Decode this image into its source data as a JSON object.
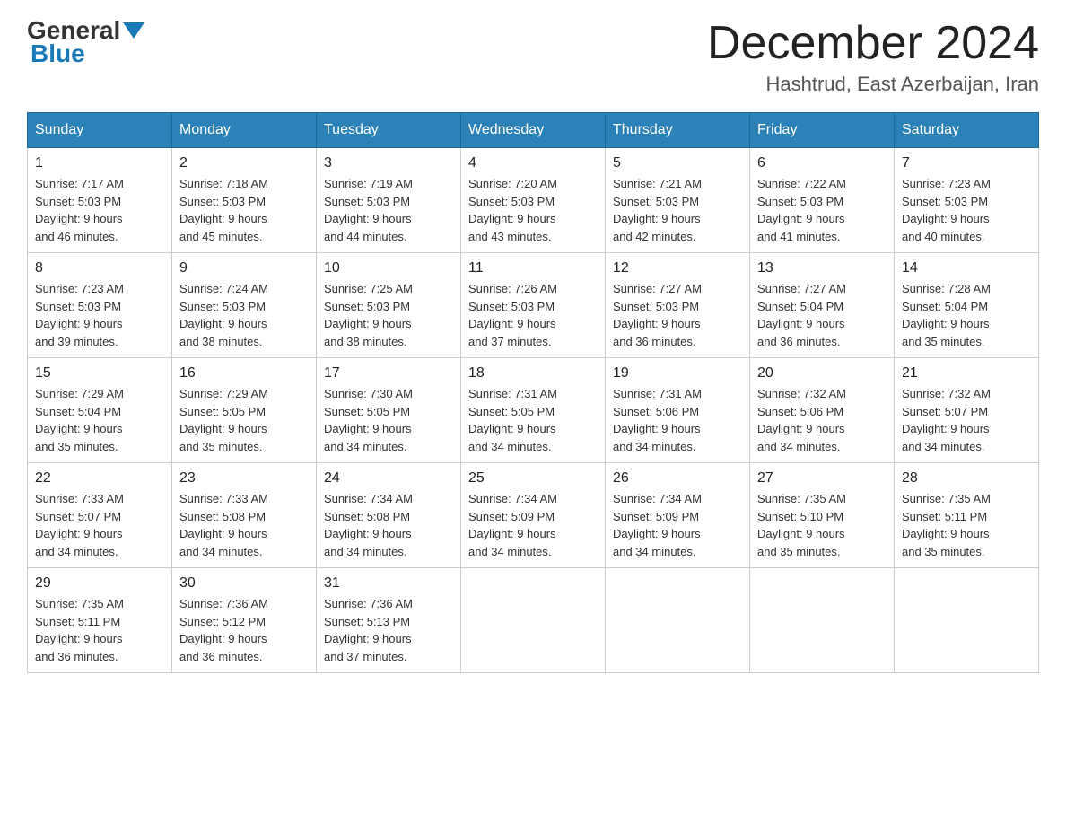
{
  "header": {
    "logo_general": "General",
    "logo_blue": "Blue",
    "main_title": "December 2024",
    "subtitle": "Hashtrud, East Azerbaijan, Iran"
  },
  "days_of_week": [
    "Sunday",
    "Monday",
    "Tuesday",
    "Wednesday",
    "Thursday",
    "Friday",
    "Saturday"
  ],
  "weeks": [
    [
      {
        "day": "1",
        "sunrise": "7:17 AM",
        "sunset": "5:03 PM",
        "daylight": "9 hours and 46 minutes."
      },
      {
        "day": "2",
        "sunrise": "7:18 AM",
        "sunset": "5:03 PM",
        "daylight": "9 hours and 45 minutes."
      },
      {
        "day": "3",
        "sunrise": "7:19 AM",
        "sunset": "5:03 PM",
        "daylight": "9 hours and 44 minutes."
      },
      {
        "day": "4",
        "sunrise": "7:20 AM",
        "sunset": "5:03 PM",
        "daylight": "9 hours and 43 minutes."
      },
      {
        "day": "5",
        "sunrise": "7:21 AM",
        "sunset": "5:03 PM",
        "daylight": "9 hours and 42 minutes."
      },
      {
        "day": "6",
        "sunrise": "7:22 AM",
        "sunset": "5:03 PM",
        "daylight": "9 hours and 41 minutes."
      },
      {
        "day": "7",
        "sunrise": "7:23 AM",
        "sunset": "5:03 PM",
        "daylight": "9 hours and 40 minutes."
      }
    ],
    [
      {
        "day": "8",
        "sunrise": "7:23 AM",
        "sunset": "5:03 PM",
        "daylight": "9 hours and 39 minutes."
      },
      {
        "day": "9",
        "sunrise": "7:24 AM",
        "sunset": "5:03 PM",
        "daylight": "9 hours and 38 minutes."
      },
      {
        "day": "10",
        "sunrise": "7:25 AM",
        "sunset": "5:03 PM",
        "daylight": "9 hours and 38 minutes."
      },
      {
        "day": "11",
        "sunrise": "7:26 AM",
        "sunset": "5:03 PM",
        "daylight": "9 hours and 37 minutes."
      },
      {
        "day": "12",
        "sunrise": "7:27 AM",
        "sunset": "5:03 PM",
        "daylight": "9 hours and 36 minutes."
      },
      {
        "day": "13",
        "sunrise": "7:27 AM",
        "sunset": "5:04 PM",
        "daylight": "9 hours and 36 minutes."
      },
      {
        "day": "14",
        "sunrise": "7:28 AM",
        "sunset": "5:04 PM",
        "daylight": "9 hours and 35 minutes."
      }
    ],
    [
      {
        "day": "15",
        "sunrise": "7:29 AM",
        "sunset": "5:04 PM",
        "daylight": "9 hours and 35 minutes."
      },
      {
        "day": "16",
        "sunrise": "7:29 AM",
        "sunset": "5:05 PM",
        "daylight": "9 hours and 35 minutes."
      },
      {
        "day": "17",
        "sunrise": "7:30 AM",
        "sunset": "5:05 PM",
        "daylight": "9 hours and 34 minutes."
      },
      {
        "day": "18",
        "sunrise": "7:31 AM",
        "sunset": "5:05 PM",
        "daylight": "9 hours and 34 minutes."
      },
      {
        "day": "19",
        "sunrise": "7:31 AM",
        "sunset": "5:06 PM",
        "daylight": "9 hours and 34 minutes."
      },
      {
        "day": "20",
        "sunrise": "7:32 AM",
        "sunset": "5:06 PM",
        "daylight": "9 hours and 34 minutes."
      },
      {
        "day": "21",
        "sunrise": "7:32 AM",
        "sunset": "5:07 PM",
        "daylight": "9 hours and 34 minutes."
      }
    ],
    [
      {
        "day": "22",
        "sunrise": "7:33 AM",
        "sunset": "5:07 PM",
        "daylight": "9 hours and 34 minutes."
      },
      {
        "day": "23",
        "sunrise": "7:33 AM",
        "sunset": "5:08 PM",
        "daylight": "9 hours and 34 minutes."
      },
      {
        "day": "24",
        "sunrise": "7:34 AM",
        "sunset": "5:08 PM",
        "daylight": "9 hours and 34 minutes."
      },
      {
        "day": "25",
        "sunrise": "7:34 AM",
        "sunset": "5:09 PM",
        "daylight": "9 hours and 34 minutes."
      },
      {
        "day": "26",
        "sunrise": "7:34 AM",
        "sunset": "5:09 PM",
        "daylight": "9 hours and 34 minutes."
      },
      {
        "day": "27",
        "sunrise": "7:35 AM",
        "sunset": "5:10 PM",
        "daylight": "9 hours and 35 minutes."
      },
      {
        "day": "28",
        "sunrise": "7:35 AM",
        "sunset": "5:11 PM",
        "daylight": "9 hours and 35 minutes."
      }
    ],
    [
      {
        "day": "29",
        "sunrise": "7:35 AM",
        "sunset": "5:11 PM",
        "daylight": "9 hours and 36 minutes."
      },
      {
        "day": "30",
        "sunrise": "7:36 AM",
        "sunset": "5:12 PM",
        "daylight": "9 hours and 36 minutes."
      },
      {
        "day": "31",
        "sunrise": "7:36 AM",
        "sunset": "5:13 PM",
        "daylight": "9 hours and 37 minutes."
      },
      null,
      null,
      null,
      null
    ]
  ],
  "labels": {
    "sunrise_prefix": "Sunrise: ",
    "sunset_prefix": "Sunset: ",
    "daylight_prefix": "Daylight: "
  }
}
